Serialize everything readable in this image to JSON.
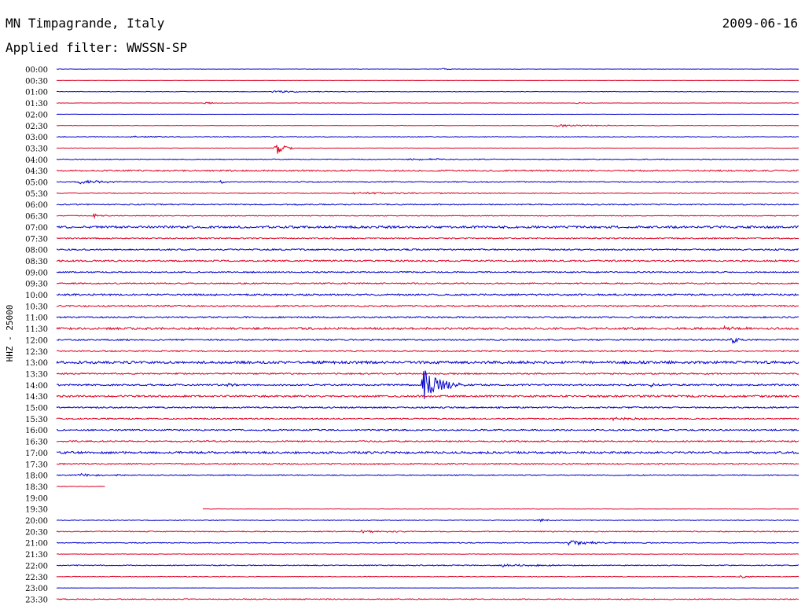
{
  "header": {
    "station": "MN Timpagrande, Italy",
    "date": "2009-06-16",
    "filter": "Applied filter: WWSSN-SP"
  },
  "chart_data": {
    "type": "helicorder",
    "title": "MN Timpagrande, Italy",
    "date": "2009-06-16",
    "filter": "WWSSN-SP",
    "ylabel": "HHZ - 25000",
    "colors": {
      "even_rows": "#0000cc",
      "odd_rows": "#dd0022"
    },
    "rows": [
      {
        "label": "00:00",
        "noise": 0.2,
        "events": [
          {
            "x": 0.52,
            "amp": 1.2,
            "dur": 0.012
          }
        ]
      },
      {
        "label": "00:30",
        "noise": 0.1,
        "events": []
      },
      {
        "label": "01:00",
        "noise": 0.3,
        "events": [
          {
            "x": 0.29,
            "amp": 1.5,
            "dur": 0.04
          }
        ]
      },
      {
        "label": "01:30",
        "noise": 0.2,
        "events": [
          {
            "x": 0.2,
            "amp": 2.0,
            "dur": 0.01
          },
          {
            "x": 0.7,
            "amp": 1.0,
            "dur": 0.01
          }
        ]
      },
      {
        "label": "02:00",
        "noise": 0.1,
        "events": []
      },
      {
        "label": "02:30",
        "noise": 0.3,
        "events": [
          {
            "x": 0.67,
            "amp": 1.5,
            "dur": 0.05
          }
        ]
      },
      {
        "label": "03:00",
        "noise": 0.4,
        "events": [
          {
            "x": 0.1,
            "amp": 1.0,
            "dur": 0.05
          }
        ]
      },
      {
        "label": "03:30",
        "noise": 0.2,
        "events": [
          {
            "x": 0.295,
            "amp": 10,
            "dur": 0.01
          }
        ]
      },
      {
        "label": "04:00",
        "noise": 0.5,
        "events": [
          {
            "x": 0.47,
            "amp": 1.2,
            "dur": 0.06
          }
        ]
      },
      {
        "label": "04:30",
        "noise": 0.9,
        "events": []
      },
      {
        "label": "05:00",
        "noise": 0.6,
        "events": [
          {
            "x": 0.03,
            "amp": 3.0,
            "dur": 0.03
          },
          {
            "x": 0.22,
            "amp": 2.0,
            "dur": 0.01
          }
        ]
      },
      {
        "label": "05:30",
        "noise": 0.5,
        "events": [
          {
            "x": 0.4,
            "amp": 1.5,
            "dur": 0.08
          }
        ]
      },
      {
        "label": "06:00",
        "noise": 0.7,
        "events": []
      },
      {
        "label": "06:30",
        "noise": 0.5,
        "events": [
          {
            "x": 0.05,
            "amp": 3.0,
            "dur": 0.01
          }
        ]
      },
      {
        "label": "07:00",
        "noise": 1.4,
        "events": []
      },
      {
        "label": "07:30",
        "noise": 0.8,
        "events": []
      },
      {
        "label": "08:00",
        "noise": 0.9,
        "events": []
      },
      {
        "label": "08:30",
        "noise": 1.0,
        "events": []
      },
      {
        "label": "09:00",
        "noise": 0.8,
        "events": []
      },
      {
        "label": "09:30",
        "noise": 0.8,
        "events": []
      },
      {
        "label": "10:00",
        "noise": 1.1,
        "events": []
      },
      {
        "label": "10:30",
        "noise": 0.9,
        "events": []
      },
      {
        "label": "11:00",
        "noise": 0.9,
        "events": []
      },
      {
        "label": "11:30",
        "noise": 1.3,
        "events": [
          {
            "x": 0.9,
            "amp": 2.0,
            "dur": 0.03
          }
        ]
      },
      {
        "label": "12:00",
        "noise": 0.9,
        "events": [
          {
            "x": 0.91,
            "amp": 6.0,
            "dur": 0.008
          }
        ]
      },
      {
        "label": "12:30",
        "noise": 0.8,
        "events": []
      },
      {
        "label": "13:00",
        "noise": 1.6,
        "events": []
      },
      {
        "label": "13:30",
        "noise": 0.9,
        "events": []
      },
      {
        "label": "14:00",
        "noise": 1.0,
        "events": [
          {
            "x": 0.494,
            "amp": 22,
            "dur": 0.02
          },
          {
            "x": 0.23,
            "amp": 2.0,
            "dur": 0.01
          },
          {
            "x": 0.8,
            "amp": 2.0,
            "dur": 0.02
          }
        ]
      },
      {
        "label": "14:30",
        "noise": 1.2,
        "events": []
      },
      {
        "label": "15:00",
        "noise": 0.9,
        "events": []
      },
      {
        "label": "15:30",
        "noise": 0.8,
        "events": [
          {
            "x": 0.75,
            "amp": 3.0,
            "dur": 0.02
          }
        ]
      },
      {
        "label": "16:00",
        "noise": 0.9,
        "events": []
      },
      {
        "label": "16:30",
        "noise": 0.9,
        "events": []
      },
      {
        "label": "17:00",
        "noise": 1.3,
        "events": []
      },
      {
        "label": "17:30",
        "noise": 0.8,
        "events": []
      },
      {
        "label": "18:00",
        "noise": 0.6,
        "events": [
          {
            "x": 0.03,
            "amp": 2.0,
            "dur": 0.03
          }
        ],
        "end": 1.0
      },
      {
        "label": "18:30",
        "noise": 0.3,
        "events": [],
        "end": 0.065
      },
      {
        "label": "19:00",
        "noise": 0.0,
        "events": [],
        "end": 0.0
      },
      {
        "label": "19:30",
        "noise": 0.3,
        "events": [],
        "start": 0.197
      },
      {
        "label": "20:00",
        "noise": 0.4,
        "events": [
          {
            "x": 0.65,
            "amp": 1.5,
            "dur": 0.02
          }
        ]
      },
      {
        "label": "20:30",
        "noise": 0.6,
        "events": [
          {
            "x": 0.41,
            "amp": 1.5,
            "dur": 0.03
          }
        ]
      },
      {
        "label": "21:00",
        "noise": 0.5,
        "events": [
          {
            "x": 0.69,
            "amp": 3.0,
            "dur": 0.04
          }
        ]
      },
      {
        "label": "21:30",
        "noise": 0.3,
        "events": []
      },
      {
        "label": "22:00",
        "noise": 0.6,
        "events": [
          {
            "x": 0.6,
            "amp": 1.5,
            "dur": 0.07
          }
        ]
      },
      {
        "label": "22:30",
        "noise": 0.4,
        "events": [
          {
            "x": 0.92,
            "amp": 2.0,
            "dur": 0.01
          }
        ]
      },
      {
        "label": "23:00",
        "noise": 0.1,
        "events": []
      },
      {
        "label": "23:30",
        "noise": 0.6,
        "events": []
      }
    ]
  }
}
